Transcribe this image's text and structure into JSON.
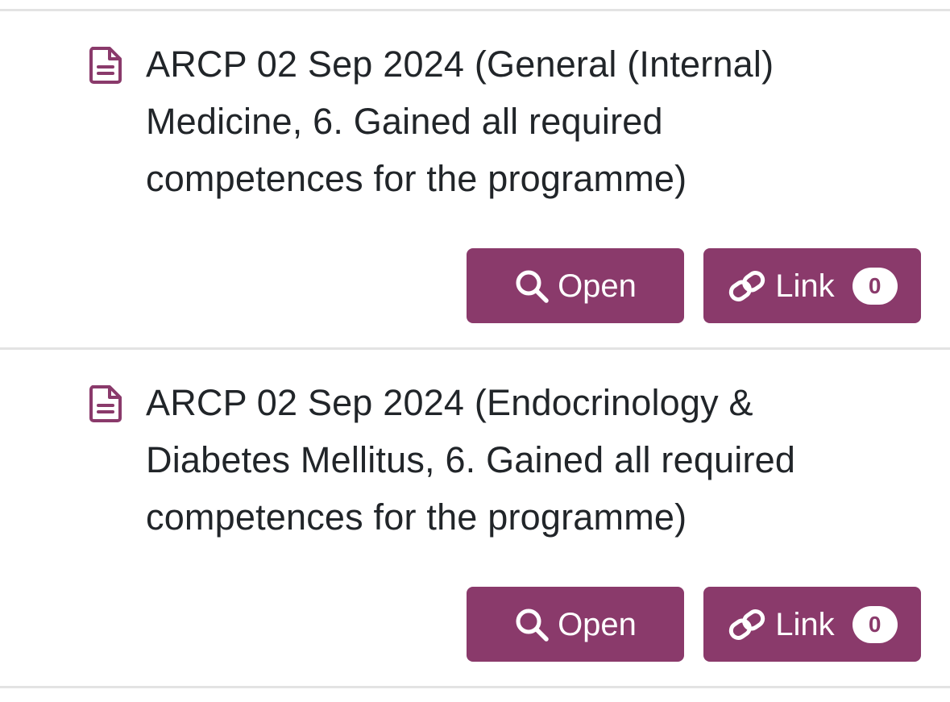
{
  "colors": {
    "accent": "#8a3a6b",
    "text": "#212529",
    "divider": "#e3e3e3",
    "badge_bg": "#ffffff"
  },
  "records": [
    {
      "icon": "document-icon",
      "title_lines": [
        "ARCP 02 Sep 2024 (General (Internal)",
        "Medicine, 6. Gained all required",
        "competences for the programme)"
      ],
      "open_button": {
        "icon": "search-icon",
        "label": "Open"
      },
      "link_button": {
        "icon": "link-icon",
        "label": "Link",
        "count": "0"
      }
    },
    {
      "icon": "document-icon",
      "title_lines": [
        "ARCP 02 Sep 2024 (Endocrinology &",
        "Diabetes Mellitus, 6. Gained all required",
        "competences for the programme)"
      ],
      "open_button": {
        "icon": "search-icon",
        "label": "Open"
      },
      "link_button": {
        "icon": "link-icon",
        "label": "Link",
        "count": "0"
      }
    }
  ]
}
